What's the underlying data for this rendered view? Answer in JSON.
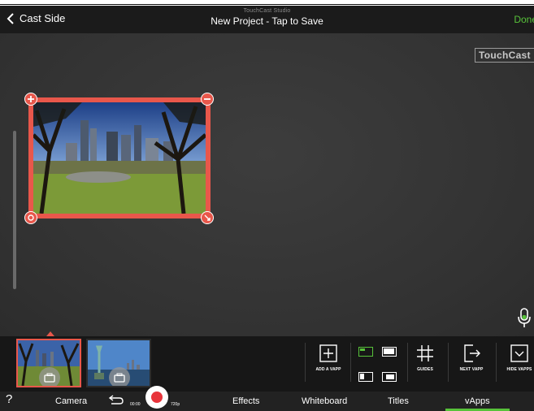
{
  "header": {
    "back_label": "Cast Side",
    "studio_label": "TouchCast Studio",
    "project_title": "New Project - Tap to Save",
    "done_label": "Done"
  },
  "canvas": {
    "logo_text": "TouchCast"
  },
  "thumbnails": [
    {
      "name": "park-scene",
      "active": true
    },
    {
      "name": "statue-of-liberty-scene",
      "active": false
    }
  ],
  "tools": {
    "add_vapp": "ADD A VAPP",
    "guides": "GUIDES",
    "next_vapp": "NEXT VAPP",
    "hide_vapps": "HIDE VAPPS"
  },
  "recorder": {
    "timer": "00:00",
    "resolution": "720p"
  },
  "tabbar": {
    "help": "?",
    "tabs": [
      "Camera",
      "Effects",
      "Whiteboard",
      "Titles",
      "vApps"
    ],
    "active_tab": "vApps"
  },
  "colors": {
    "accent_red": "#e8574b",
    "accent_green": "#57c23a",
    "header_bg": "#1b1b1b",
    "canvas_bg": "#333333"
  },
  "icons": [
    "back-chevron-icon",
    "plus-icon",
    "minus-icon",
    "rotate-icon",
    "resize-icon",
    "microphone-icon",
    "camera-icon",
    "add-vapp-icon",
    "guides-icon",
    "next-vapp-icon",
    "hide-vapps-icon",
    "undo-icon",
    "record-icon",
    "help-icon"
  ]
}
